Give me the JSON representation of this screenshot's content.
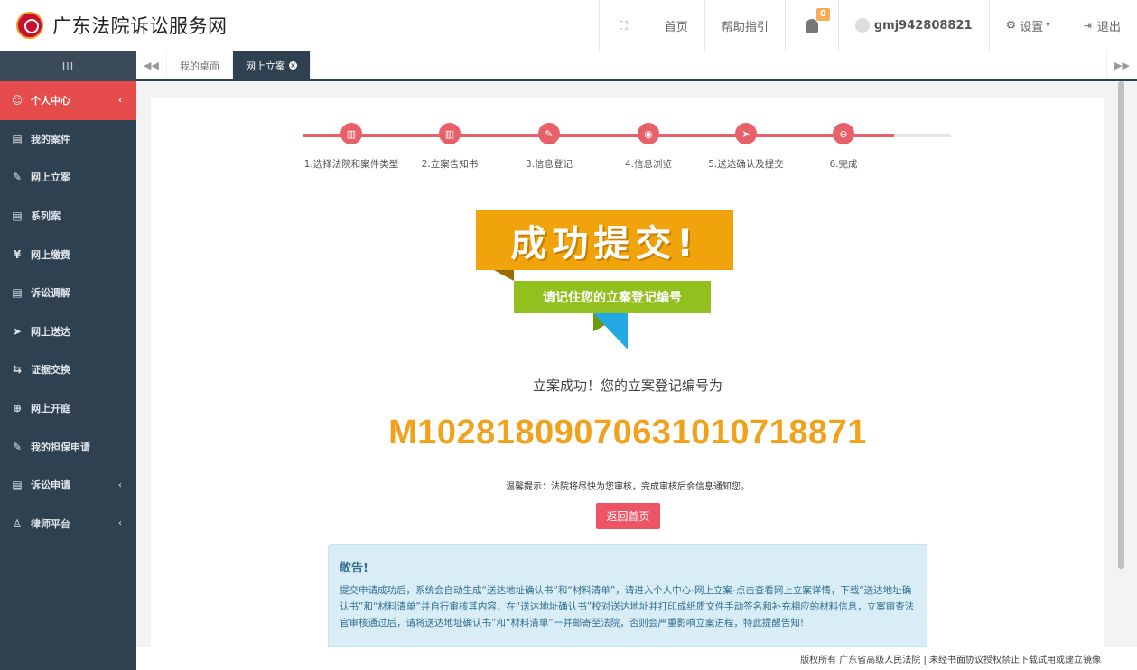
{
  "header": {
    "site_title": "广东法院诉讼服务网",
    "nav": {
      "home": "首页",
      "help": "帮助指引",
      "notifications_count": "0",
      "username": "gmj942808821",
      "settings": "设置",
      "logout": "退出"
    }
  },
  "sidebar": {
    "toggle": "III",
    "items": [
      {
        "label": "个人中心",
        "icon": "user-circle-icon",
        "active": true,
        "has_arrow": true
      },
      {
        "label": "我的案件",
        "icon": "document-icon"
      },
      {
        "label": "网上立案",
        "icon": "edit-icon"
      },
      {
        "label": "系列案",
        "icon": "document-icon"
      },
      {
        "label": "网上缴费",
        "icon": "yen-icon"
      },
      {
        "label": "诉讼调解",
        "icon": "document-icon"
      },
      {
        "label": "网上送达",
        "icon": "send-icon"
      },
      {
        "label": "证据交换",
        "icon": "exchange-icon"
      },
      {
        "label": "网上开庭",
        "icon": "globe-icon"
      },
      {
        "label": "我的担保申请",
        "icon": "edit-icon"
      },
      {
        "label": "诉讼申请",
        "icon": "document-icon",
        "has_arrow": true
      },
      {
        "label": "律师平台",
        "icon": "person-icon",
        "has_arrow": true
      }
    ]
  },
  "tabs": {
    "items": [
      {
        "label": "我的桌面",
        "active": false
      },
      {
        "label": "网上立案",
        "active": true
      }
    ]
  },
  "steps": [
    {
      "label": "1.选择法院和案件类型",
      "icon": "book-icon"
    },
    {
      "label": "2.立案告知书",
      "icon": "book-icon"
    },
    {
      "label": "3.信息登记",
      "icon": "edit-icon"
    },
    {
      "label": "4.信息浏览",
      "icon": "eye-icon"
    },
    {
      "label": "5.送达确认及提交",
      "icon": "send-icon"
    },
    {
      "label": "6.完成",
      "icon": "check-circle-icon"
    }
  ],
  "banner": {
    "main": "成功提交!",
    "sub": "请记住您的立案登记编号"
  },
  "result": {
    "message": "立案成功！您的立案登记编号为",
    "registration_number": "M10281809070631010718871",
    "tip": "温馨提示：法院将尽快为您审核，完成审核后会信息通知您。",
    "return_button": "返回首页"
  },
  "notice": {
    "title": "敬告!",
    "body": "提交申请成功后，系统会自动生成“送达地址确认书”和“材料清单”，请进入个人中心-网上立案-点击查看网上立案详情，下载“送达地址确认书”和“材料清单”并自行审核其内容，在“送达地址确认书”校对送达地址并打印成纸质文件手动签名和补充相应的材料信息，立案审查法官审核通过后，请将送达地址确认书”和“材料清单”一并邮寄至法院，否则会严重影响立案进程，特此提醒告知!"
  },
  "footer": {
    "text": "版权所有 广东省高级人民法院 | 未经书面协议授权禁止下载试用或建立镜像"
  },
  "colors": {
    "sidebar_bg": "#2f4050",
    "active_red": "#e74c4c",
    "step_red": "#e8616a",
    "number_orange": "#f0a21c",
    "banner_orange": "#f0a30a",
    "banner_green": "#92c01f"
  }
}
